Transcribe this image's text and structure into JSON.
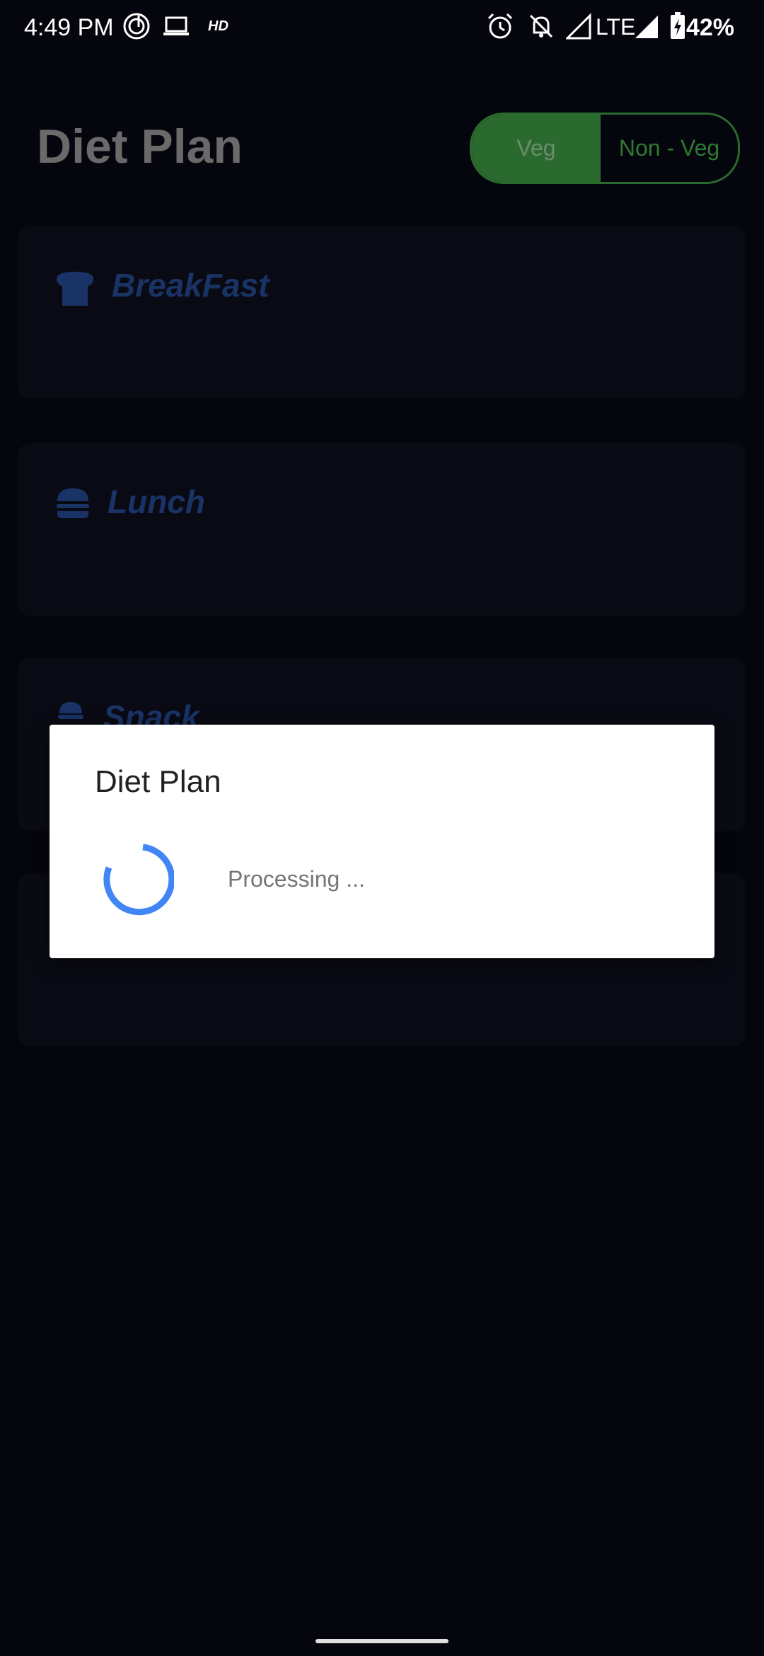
{
  "status_bar": {
    "time": "4:49 PM",
    "network": "LTE",
    "battery": "42%",
    "icons": [
      "music-app-icon",
      "laptop-icon",
      "hd-icon",
      "alarm-icon",
      "bell-off-icon",
      "signal-icon",
      "signal-icon",
      "battery-charging-icon"
    ]
  },
  "header": {
    "title": "Diet Plan",
    "toggle": {
      "options": [
        "Veg",
        "Non - Veg"
      ],
      "selected": "Veg"
    }
  },
  "meals": [
    {
      "label": "BreakFast",
      "icon": "bread-icon"
    },
    {
      "label": "Lunch",
      "icon": "burger-icon"
    },
    {
      "label": "Snack",
      "icon": "ice-cream-icon"
    }
  ],
  "dialog": {
    "title": "Diet Plan",
    "message": "Processing ..."
  },
  "colors": {
    "background": "#05050d",
    "toggle_active": "#2b6a2e",
    "meal_title": "#1a3366",
    "spinner": "#4285f4"
  }
}
